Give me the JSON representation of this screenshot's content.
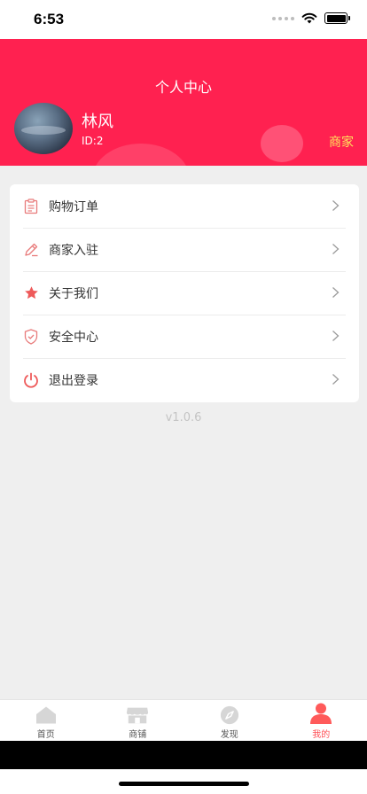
{
  "status_bar": {
    "time": "6:53"
  },
  "header": {
    "title": "个人中心",
    "user_name": "林风",
    "user_id": "ID:2",
    "merchant_label": "商家",
    "background_color": "#ff2150"
  },
  "menu": {
    "items": [
      {
        "label": "购物订单",
        "icon": "clipboard-icon"
      },
      {
        "label": "商家入驻",
        "icon": "pencil-icon"
      },
      {
        "label": "关于我们",
        "icon": "star-icon"
      },
      {
        "label": "安全中心",
        "icon": "shield-icon"
      },
      {
        "label": "退出登录",
        "icon": "power-icon"
      }
    ]
  },
  "version": "v1.0.6",
  "tabs": [
    {
      "label": "首页",
      "icon": "home-icon",
      "active": false
    },
    {
      "label": "商铺",
      "icon": "store-icon",
      "active": false
    },
    {
      "label": "发现",
      "icon": "compass-icon",
      "active": false
    },
    {
      "label": "我的",
      "icon": "person-icon",
      "active": true
    }
  ],
  "colors": {
    "accent": "#ff4f55",
    "merchant_text": "#ffe35b"
  }
}
